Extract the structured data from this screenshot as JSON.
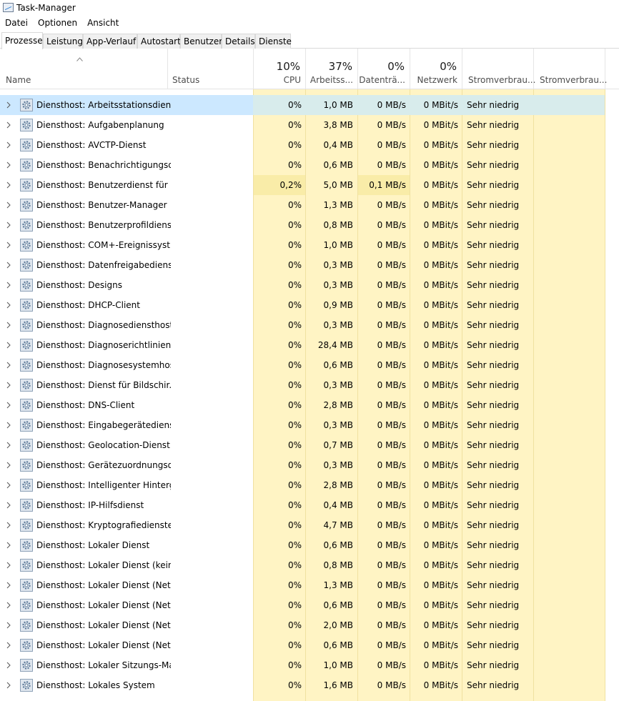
{
  "window": {
    "title": "Task-Manager"
  },
  "menu": [
    "Datei",
    "Optionen",
    "Ansicht"
  ],
  "tabs": [
    {
      "label": "Prozesse",
      "active": true
    },
    {
      "label": "Leistung",
      "active": false
    },
    {
      "label": "App-Verlauf",
      "active": false
    },
    {
      "label": "Autostart",
      "active": false
    },
    {
      "label": "Benutzer",
      "active": false
    },
    {
      "label": "Details",
      "active": false
    },
    {
      "label": "Dienste",
      "active": false
    }
  ],
  "columns": {
    "name": "Name",
    "status": "Status",
    "cpu": {
      "pct": "10%",
      "label": "CPU"
    },
    "memory": {
      "pct": "37%",
      "label": "Arbeitss..."
    },
    "disk": {
      "pct": "0%",
      "label": "Datenträ..."
    },
    "network": {
      "pct": "0%",
      "label": "Netzwerk"
    },
    "power": "Stromverbrau...",
    "power_trend": "Stromverbrau..."
  },
  "colors": {
    "heat": "#fff4c4",
    "heat_high": "#f9eca8",
    "selected": "#cce8ff",
    "accent": "#0078d7"
  },
  "rows": [
    {
      "name": "Diensthost: Arbeitsstationsdienst",
      "cpu": "0%",
      "mem": "1,0 MB",
      "disk": "0 MB/s",
      "net": "0 MBit/s",
      "power": "Sehr niedrig",
      "selected": true
    },
    {
      "name": "Diensthost: Aufgabenplanung",
      "cpu": "0%",
      "mem": "3,8 MB",
      "disk": "0 MB/s",
      "net": "0 MBit/s",
      "power": "Sehr niedrig"
    },
    {
      "name": "Diensthost: AVCTP-Dienst",
      "cpu": "0%",
      "mem": "0,4 MB",
      "disk": "0 MB/s",
      "net": "0 MBit/s",
      "power": "Sehr niedrig"
    },
    {
      "name": "Diensthost: Benachrichtigungsd...",
      "cpu": "0%",
      "mem": "0,6 MB",
      "disk": "0 MB/s",
      "net": "0 MBit/s",
      "power": "Sehr niedrig"
    },
    {
      "name": "Diensthost: Benutzerdienst für d...",
      "cpu": "0,2%",
      "mem": "5,0 MB",
      "disk": "0,1 MB/s",
      "net": "0 MBit/s",
      "power": "Sehr niedrig",
      "hi": true
    },
    {
      "name": "Diensthost: Benutzer-Manager",
      "cpu": "0%",
      "mem": "1,3 MB",
      "disk": "0 MB/s",
      "net": "0 MBit/s",
      "power": "Sehr niedrig"
    },
    {
      "name": "Diensthost: Benutzerprofildienst",
      "cpu": "0%",
      "mem": "0,8 MB",
      "disk": "0 MB/s",
      "net": "0 MBit/s",
      "power": "Sehr niedrig"
    },
    {
      "name": "Diensthost: COM+-Ereignissyst...",
      "cpu": "0%",
      "mem": "1,0 MB",
      "disk": "0 MB/s",
      "net": "0 MBit/s",
      "power": "Sehr niedrig"
    },
    {
      "name": "Diensthost: Datenfreigabedienst",
      "cpu": "0%",
      "mem": "0,3 MB",
      "disk": "0 MB/s",
      "net": "0 MBit/s",
      "power": "Sehr niedrig"
    },
    {
      "name": "Diensthost: Designs",
      "cpu": "0%",
      "mem": "0,3 MB",
      "disk": "0 MB/s",
      "net": "0 MBit/s",
      "power": "Sehr niedrig"
    },
    {
      "name": "Diensthost: DHCP-Client",
      "cpu": "0%",
      "mem": "0,9 MB",
      "disk": "0 MB/s",
      "net": "0 MBit/s",
      "power": "Sehr niedrig"
    },
    {
      "name": "Diensthost: Diagnosediensthost",
      "cpu": "0%",
      "mem": "0,3 MB",
      "disk": "0 MB/s",
      "net": "0 MBit/s",
      "power": "Sehr niedrig"
    },
    {
      "name": "Diensthost: Diagnoserichtlinien...",
      "cpu": "0%",
      "mem": "28,4 MB",
      "disk": "0 MB/s",
      "net": "0 MBit/s",
      "power": "Sehr niedrig"
    },
    {
      "name": "Diensthost: Diagnosesystemhost",
      "cpu": "0%",
      "mem": "0,6 MB",
      "disk": "0 MB/s",
      "net": "0 MBit/s",
      "power": "Sehr niedrig"
    },
    {
      "name": "Diensthost: Dienst für Bildschir...",
      "cpu": "0%",
      "mem": "0,3 MB",
      "disk": "0 MB/s",
      "net": "0 MBit/s",
      "power": "Sehr niedrig"
    },
    {
      "name": "Diensthost: DNS-Client",
      "cpu": "0%",
      "mem": "2,8 MB",
      "disk": "0 MB/s",
      "net": "0 MBit/s",
      "power": "Sehr niedrig"
    },
    {
      "name": "Diensthost: Eingabegerätedienst",
      "cpu": "0%",
      "mem": "0,3 MB",
      "disk": "0 MB/s",
      "net": "0 MBit/s",
      "power": "Sehr niedrig"
    },
    {
      "name": "Diensthost: Geolocation-Dienst",
      "cpu": "0%",
      "mem": "0,7 MB",
      "disk": "0 MB/s",
      "net": "0 MBit/s",
      "power": "Sehr niedrig"
    },
    {
      "name": "Diensthost: Gerätezuordnungsdi...",
      "cpu": "0%",
      "mem": "0,3 MB",
      "disk": "0 MB/s",
      "net": "0 MBit/s",
      "power": "Sehr niedrig"
    },
    {
      "name": "Diensthost: Intelligenter Hinterg...",
      "cpu": "0%",
      "mem": "2,8 MB",
      "disk": "0 MB/s",
      "net": "0 MBit/s",
      "power": "Sehr niedrig"
    },
    {
      "name": "Diensthost: IP-Hilfsdienst",
      "cpu": "0%",
      "mem": "0,4 MB",
      "disk": "0 MB/s",
      "net": "0 MBit/s",
      "power": "Sehr niedrig"
    },
    {
      "name": "Diensthost: Kryptografiedienste",
      "cpu": "0%",
      "mem": "4,7 MB",
      "disk": "0 MB/s",
      "net": "0 MBit/s",
      "power": "Sehr niedrig"
    },
    {
      "name": "Diensthost: Lokaler Dienst",
      "cpu": "0%",
      "mem": "0,6 MB",
      "disk": "0 MB/s",
      "net": "0 MBit/s",
      "power": "Sehr niedrig"
    },
    {
      "name": "Diensthost: Lokaler Dienst (kein ...",
      "cpu": "0%",
      "mem": "0,8 MB",
      "disk": "0 MB/s",
      "net": "0 MBit/s",
      "power": "Sehr niedrig"
    },
    {
      "name": "Diensthost: Lokaler Dienst (Netz...",
      "cpu": "0%",
      "mem": "1,3 MB",
      "disk": "0 MB/s",
      "net": "0 MBit/s",
      "power": "Sehr niedrig"
    },
    {
      "name": "Diensthost: Lokaler Dienst (Netz...",
      "cpu": "0%",
      "mem": "0,6 MB",
      "disk": "0 MB/s",
      "net": "0 MBit/s",
      "power": "Sehr niedrig"
    },
    {
      "name": "Diensthost: Lokaler Dienst (Netz...",
      "cpu": "0%",
      "mem": "2,0 MB",
      "disk": "0 MB/s",
      "net": "0 MBit/s",
      "power": "Sehr niedrig"
    },
    {
      "name": "Diensthost: Lokaler Dienst (Netz...",
      "cpu": "0%",
      "mem": "0,6 MB",
      "disk": "0 MB/s",
      "net": "0 MBit/s",
      "power": "Sehr niedrig"
    },
    {
      "name": "Diensthost: Lokaler Sitzungs-Ma...",
      "cpu": "0%",
      "mem": "1,0 MB",
      "disk": "0 MB/s",
      "net": "0 MBit/s",
      "power": "Sehr niedrig"
    },
    {
      "name": "Diensthost: Lokales System",
      "cpu": "0%",
      "mem": "1,6 MB",
      "disk": "0 MB/s",
      "net": "0 MBit/s",
      "power": "Sehr niedrig"
    }
  ]
}
